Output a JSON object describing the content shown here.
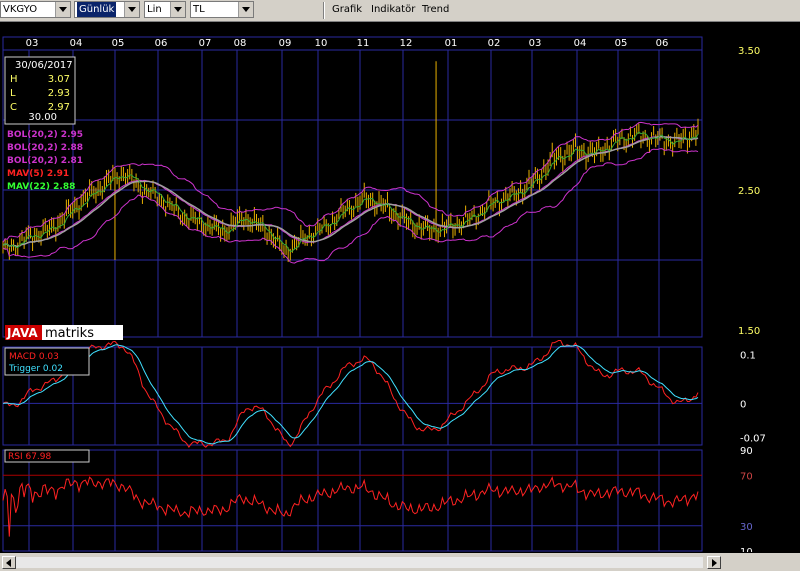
{
  "toolbar": {
    "symbol": "VKGYO",
    "period": "Günlük",
    "scale": "Lin",
    "currency": "TL",
    "menu": [
      "Grafik",
      "Indikatör",
      "Trend"
    ]
  },
  "logo": {
    "part1": "JAVA",
    "part2": "matriks"
  },
  "colors": {
    "background": "#000000",
    "grid": "#2a2aa0",
    "candle": "#e8b000",
    "bol": "#cc33cc",
    "mav5": "#ff2222",
    "mav22": "#a0a0a0",
    "macd": "#ff2222",
    "trigger": "#40e0ff",
    "rsi": "#ff2222",
    "text": "#ffffff",
    "axis_text": "#ffff66"
  },
  "chart_data": [
    {
      "type": "candlestick",
      "title": "",
      "x_ticks": [
        "03",
        "04",
        "05",
        "06",
        "07",
        "08",
        "09",
        "10",
        "11",
        "12",
        "01",
        "02",
        "03",
        "04",
        "05",
        "06"
      ],
      "y_ticks": [
        "3.50",
        "2.50",
        "1.50"
      ],
      "ylim": [
        1.5,
        3.5
      ],
      "grid": true,
      "info": {
        "date": "30/06/2017",
        "H": "3.07",
        "L": "2.93",
        "C": "2.97",
        "V": "30.00"
      },
      "legend": [
        {
          "label": "BOL(20,2)",
          "value": "2.95"
        },
        {
          "label": "BOL(20,2)",
          "value": "2.88"
        },
        {
          "label": "BOL(20,2)",
          "value": "2.81"
        },
        {
          "label": "MAV(5)",
          "value": "2.91"
        },
        {
          "label": "MAV(22)",
          "value": "2.88"
        }
      ],
      "close_path": [
        [
          0,
          2.07
        ],
        [
          7,
          2.16
        ],
        [
          14,
          2.22
        ],
        [
          22,
          2.4
        ],
        [
          30,
          2.55
        ],
        [
          35,
          2.62
        ],
        [
          40,
          2.52
        ],
        [
          46,
          2.44
        ],
        [
          52,
          2.32
        ],
        [
          58,
          2.26
        ],
        [
          64,
          2.2
        ],
        [
          70,
          2.3
        ],
        [
          76,
          2.22
        ],
        [
          82,
          2.06
        ],
        [
          88,
          2.17
        ],
        [
          94,
          2.25
        ],
        [
          100,
          2.37
        ],
        [
          106,
          2.44
        ],
        [
          112,
          2.36
        ],
        [
          118,
          2.26
        ],
        [
          124,
          2.21
        ],
        [
          130,
          2.24
        ],
        [
          136,
          2.3
        ],
        [
          142,
          2.41
        ],
        [
          148,
          2.46
        ],
        [
          154,
          2.55
        ],
        [
          160,
          2.72
        ],
        [
          166,
          2.78
        ],
        [
          172,
          2.76
        ],
        [
          178,
          2.85
        ],
        [
          184,
          2.9
        ],
        [
          190,
          2.87
        ],
        [
          196,
          2.84
        ],
        [
          202,
          2.92
        ]
      ],
      "x_range": [
        0,
        202
      ]
    },
    {
      "type": "line",
      "title": "",
      "legend": [
        {
          "label": "MACD",
          "value": "0.03"
        },
        {
          "label": "Trigger",
          "value": "0.02"
        }
      ],
      "y_ticks": [
        "0.1",
        "0",
        "-0.07"
      ],
      "ylim": [
        -0.085,
        0.115
      ]
    },
    {
      "type": "line",
      "title": "",
      "legend": [
        {
          "label": "RSI",
          "value": "67.98"
        }
      ],
      "y_ticks": [
        "90",
        "70",
        "30",
        "10"
      ],
      "ylim": [
        10,
        90
      ],
      "reference_lines": [
        70,
        30
      ]
    }
  ]
}
